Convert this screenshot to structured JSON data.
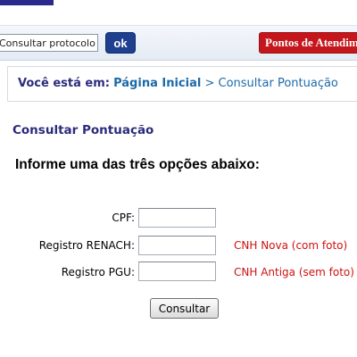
{
  "topbar": {
    "protocol_input_value": "Consultar protocolo",
    "ok_label": "ok",
    "pontos_label": "Pontos de Atendimento"
  },
  "breadcrumb": {
    "prefix": "Você está em:",
    "home": "Página Inicial",
    "separator": ">",
    "current": "Consultar Pontuação"
  },
  "page": {
    "title": "Consultar Pontuação",
    "instructions": "Informe uma das três opções abaixo:"
  },
  "form": {
    "cpf_label": "CPF:",
    "cpf_value": "",
    "renach_label": "Registro RENACH:",
    "renach_value": "",
    "renach_hint": "CNH Nova (com foto)",
    "pgu_label": "Registro PGU:",
    "pgu_value": "",
    "pgu_hint": "CNH Antiga (sem foto)",
    "submit_label": "Consultar"
  },
  "colors": {
    "brand_blue": "#2c2c7c",
    "link_blue": "#1d6aa8",
    "ok_button": "#1f3f8f",
    "pontos_button": "#c4161c",
    "hint_red": "#d01010"
  }
}
